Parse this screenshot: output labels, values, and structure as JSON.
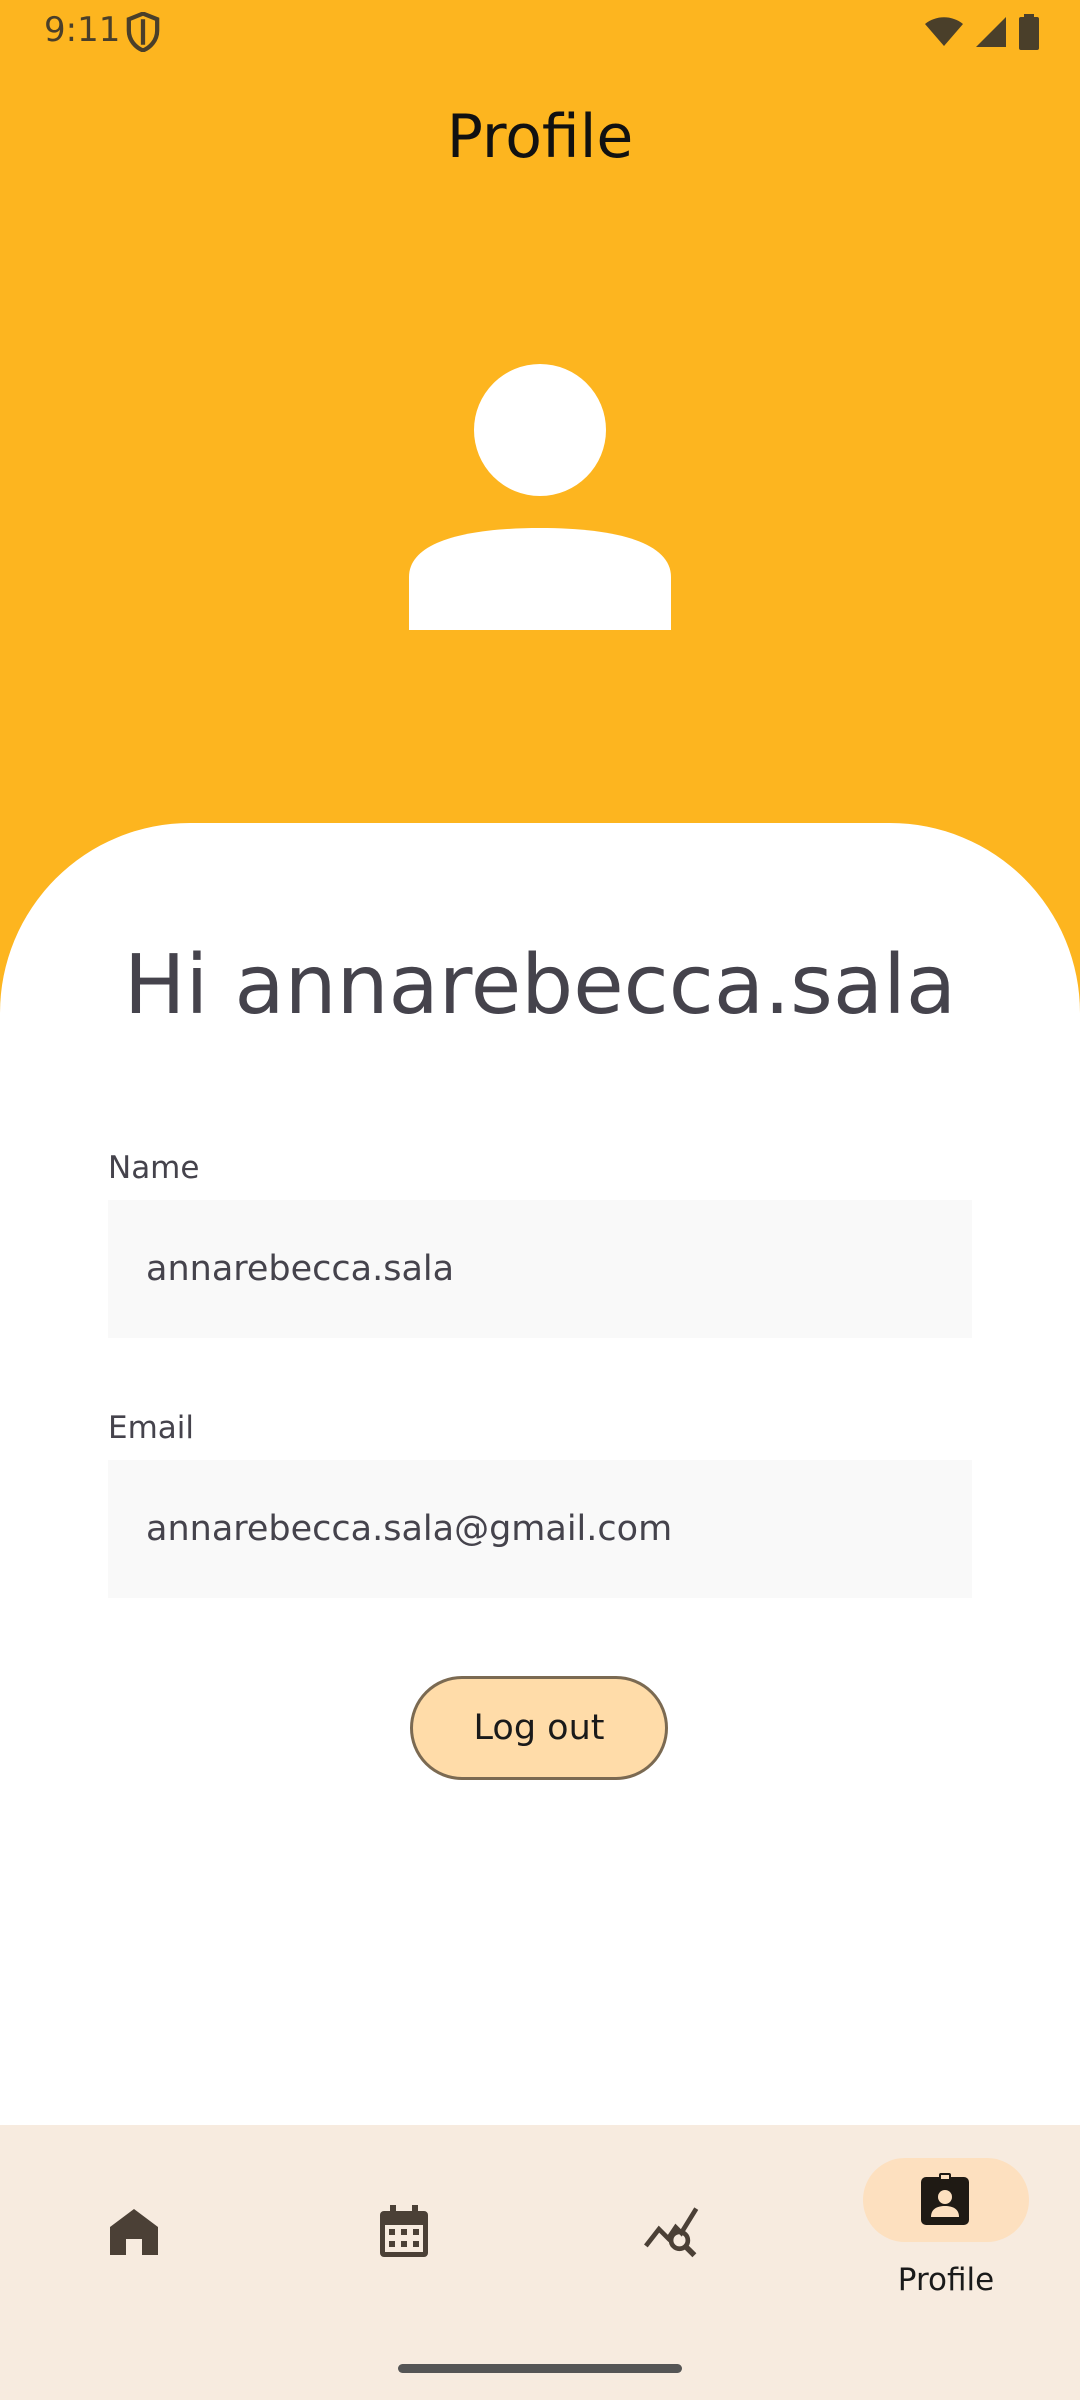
{
  "status_bar": {
    "time": "9:11",
    "icons": [
      "shield-icon",
      "wifi-icon",
      "signal-icon",
      "battery-icon"
    ]
  },
  "header": {
    "title": "Profile",
    "background_color": "#fdb51f",
    "avatar_icon": "person-icon"
  },
  "profile": {
    "greeting": "Hi annarebecca.sala",
    "name_label": "Name",
    "name_value": "annarebecca.sala",
    "email_label": "Email",
    "email_value": "annarebecca.sala@gmail.com",
    "logout_label": "Log out"
  },
  "bottom_nav": {
    "items": [
      {
        "icon": "home-icon",
        "label": ""
      },
      {
        "icon": "calendar-icon",
        "label": ""
      },
      {
        "icon": "stats-search-icon",
        "label": ""
      },
      {
        "icon": "profile-badge-icon",
        "label": "Profile",
        "selected": true
      }
    ],
    "background_color": "#f7ebdf",
    "selected_pill_color": "#fde0bf"
  }
}
